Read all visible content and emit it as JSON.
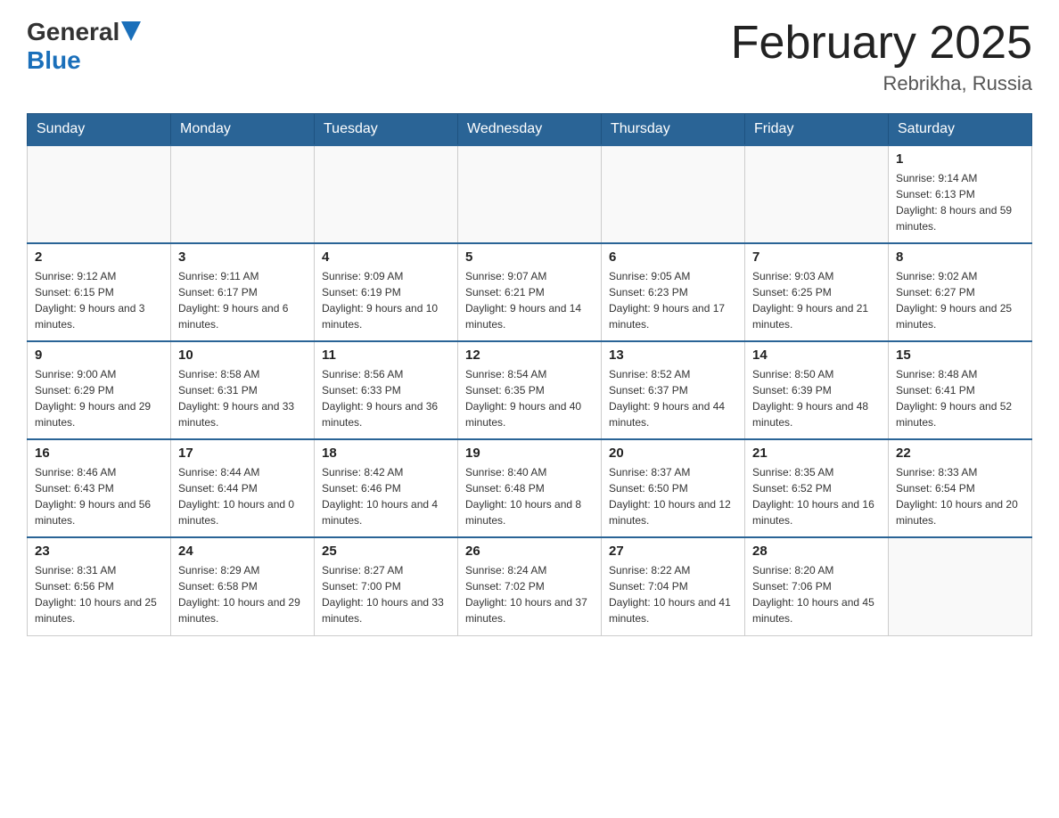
{
  "header": {
    "logo_general": "General",
    "logo_blue": "Blue",
    "month_title": "February 2025",
    "location": "Rebrikha, Russia"
  },
  "days_of_week": [
    "Sunday",
    "Monday",
    "Tuesday",
    "Wednesday",
    "Thursday",
    "Friday",
    "Saturday"
  ],
  "weeks": [
    [
      {
        "day": "",
        "info": ""
      },
      {
        "day": "",
        "info": ""
      },
      {
        "day": "",
        "info": ""
      },
      {
        "day": "",
        "info": ""
      },
      {
        "day": "",
        "info": ""
      },
      {
        "day": "",
        "info": ""
      },
      {
        "day": "1",
        "info": "Sunrise: 9:14 AM\nSunset: 6:13 PM\nDaylight: 8 hours and 59 minutes."
      }
    ],
    [
      {
        "day": "2",
        "info": "Sunrise: 9:12 AM\nSunset: 6:15 PM\nDaylight: 9 hours and 3 minutes."
      },
      {
        "day": "3",
        "info": "Sunrise: 9:11 AM\nSunset: 6:17 PM\nDaylight: 9 hours and 6 minutes."
      },
      {
        "day": "4",
        "info": "Sunrise: 9:09 AM\nSunset: 6:19 PM\nDaylight: 9 hours and 10 minutes."
      },
      {
        "day": "5",
        "info": "Sunrise: 9:07 AM\nSunset: 6:21 PM\nDaylight: 9 hours and 14 minutes."
      },
      {
        "day": "6",
        "info": "Sunrise: 9:05 AM\nSunset: 6:23 PM\nDaylight: 9 hours and 17 minutes."
      },
      {
        "day": "7",
        "info": "Sunrise: 9:03 AM\nSunset: 6:25 PM\nDaylight: 9 hours and 21 minutes."
      },
      {
        "day": "8",
        "info": "Sunrise: 9:02 AM\nSunset: 6:27 PM\nDaylight: 9 hours and 25 minutes."
      }
    ],
    [
      {
        "day": "9",
        "info": "Sunrise: 9:00 AM\nSunset: 6:29 PM\nDaylight: 9 hours and 29 minutes."
      },
      {
        "day": "10",
        "info": "Sunrise: 8:58 AM\nSunset: 6:31 PM\nDaylight: 9 hours and 33 minutes."
      },
      {
        "day": "11",
        "info": "Sunrise: 8:56 AM\nSunset: 6:33 PM\nDaylight: 9 hours and 36 minutes."
      },
      {
        "day": "12",
        "info": "Sunrise: 8:54 AM\nSunset: 6:35 PM\nDaylight: 9 hours and 40 minutes."
      },
      {
        "day": "13",
        "info": "Sunrise: 8:52 AM\nSunset: 6:37 PM\nDaylight: 9 hours and 44 minutes."
      },
      {
        "day": "14",
        "info": "Sunrise: 8:50 AM\nSunset: 6:39 PM\nDaylight: 9 hours and 48 minutes."
      },
      {
        "day": "15",
        "info": "Sunrise: 8:48 AM\nSunset: 6:41 PM\nDaylight: 9 hours and 52 minutes."
      }
    ],
    [
      {
        "day": "16",
        "info": "Sunrise: 8:46 AM\nSunset: 6:43 PM\nDaylight: 9 hours and 56 minutes."
      },
      {
        "day": "17",
        "info": "Sunrise: 8:44 AM\nSunset: 6:44 PM\nDaylight: 10 hours and 0 minutes."
      },
      {
        "day": "18",
        "info": "Sunrise: 8:42 AM\nSunset: 6:46 PM\nDaylight: 10 hours and 4 minutes."
      },
      {
        "day": "19",
        "info": "Sunrise: 8:40 AM\nSunset: 6:48 PM\nDaylight: 10 hours and 8 minutes."
      },
      {
        "day": "20",
        "info": "Sunrise: 8:37 AM\nSunset: 6:50 PM\nDaylight: 10 hours and 12 minutes."
      },
      {
        "day": "21",
        "info": "Sunrise: 8:35 AM\nSunset: 6:52 PM\nDaylight: 10 hours and 16 minutes."
      },
      {
        "day": "22",
        "info": "Sunrise: 8:33 AM\nSunset: 6:54 PM\nDaylight: 10 hours and 20 minutes."
      }
    ],
    [
      {
        "day": "23",
        "info": "Sunrise: 8:31 AM\nSunset: 6:56 PM\nDaylight: 10 hours and 25 minutes."
      },
      {
        "day": "24",
        "info": "Sunrise: 8:29 AM\nSunset: 6:58 PM\nDaylight: 10 hours and 29 minutes."
      },
      {
        "day": "25",
        "info": "Sunrise: 8:27 AM\nSunset: 7:00 PM\nDaylight: 10 hours and 33 minutes."
      },
      {
        "day": "26",
        "info": "Sunrise: 8:24 AM\nSunset: 7:02 PM\nDaylight: 10 hours and 37 minutes."
      },
      {
        "day": "27",
        "info": "Sunrise: 8:22 AM\nSunset: 7:04 PM\nDaylight: 10 hours and 41 minutes."
      },
      {
        "day": "28",
        "info": "Sunrise: 8:20 AM\nSunset: 7:06 PM\nDaylight: 10 hours and 45 minutes."
      },
      {
        "day": "",
        "info": ""
      }
    ]
  ]
}
